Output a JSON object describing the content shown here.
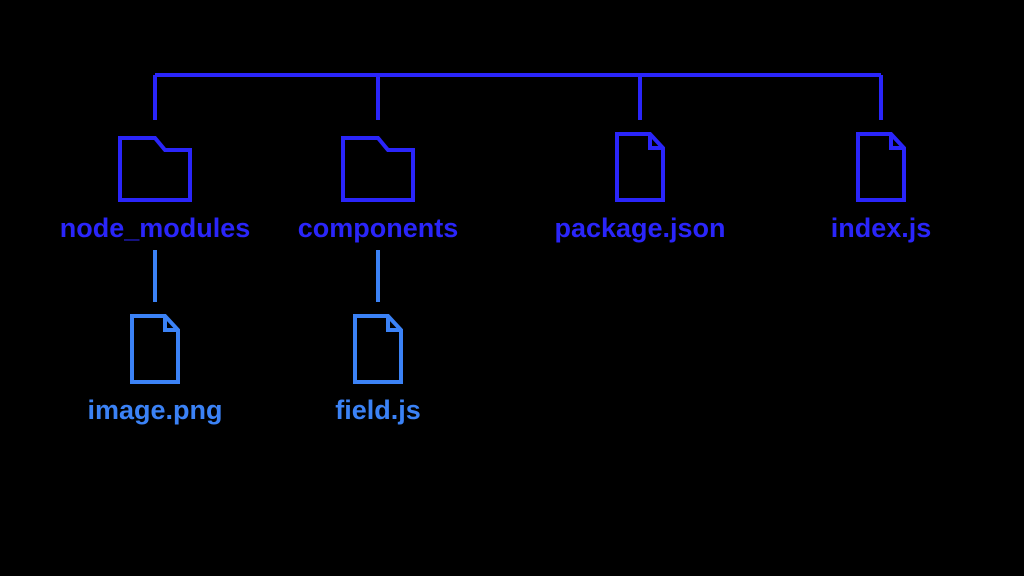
{
  "tree": {
    "root": {
      "children": [
        {
          "type": "folder",
          "label": "node_modules",
          "children": [
            {
              "type": "file",
              "label": "image.png"
            }
          ]
        },
        {
          "type": "folder",
          "label": "components",
          "children": [
            {
              "type": "file",
              "label": "field.js"
            }
          ]
        },
        {
          "type": "file",
          "label": "package.json"
        },
        {
          "type": "file",
          "label": "index.js"
        }
      ]
    }
  },
  "labels": {
    "node_modules": "node_modules",
    "components": "components",
    "package_json": "package.json",
    "index_js": "index.js",
    "image_png": "image.png",
    "field_js": "field.js"
  },
  "colors": {
    "dark": "#2a25fa",
    "light": "#3b82f6",
    "background": "#000000"
  }
}
